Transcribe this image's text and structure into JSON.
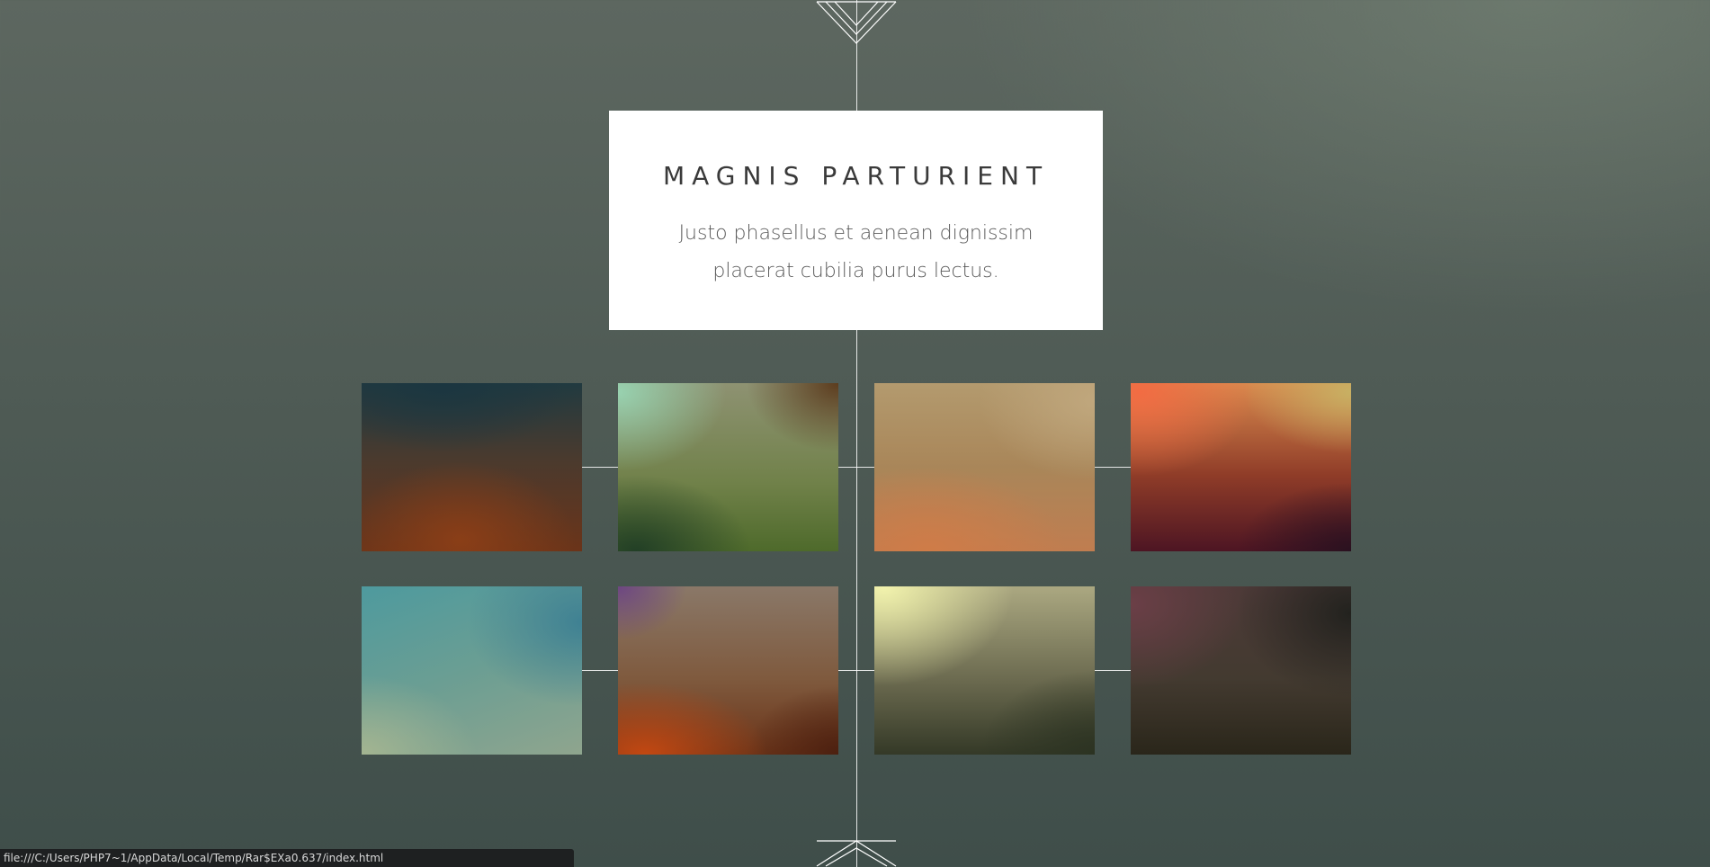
{
  "card": {
    "title": "MAGNIS PARTURIENT",
    "text_line1": "Justo phasellus et aenean dignissim",
    "text_line2": "placerat cubilia purus lectus."
  },
  "status_bar": {
    "url": "file:///C:/Users/PHP7~1/AppData/Local/Temp/Rar$EXa0.637/index.html"
  },
  "colors": {
    "background": "#4f5b55",
    "card": "#ffffff",
    "guide_line": "#ffffff"
  },
  "tiles": [
    {
      "name": "gradient-tile-dark-teal-rust",
      "colors": [
        "#1a3139",
        "#4a3a2c",
        "#7e3b18"
      ]
    },
    {
      "name": "gradient-tile-mint-olive",
      "colors": [
        "#8fc8a6",
        "#8f8b63",
        "#4d6b2f"
      ]
    },
    {
      "name": "gradient-tile-tan-orange",
      "colors": [
        "#b6996b",
        "#a98457",
        "#cc7a4a"
      ]
    },
    {
      "name": "gradient-tile-coral-plum",
      "colors": [
        "#ef7548",
        "#c7b05e",
        "#3c1321"
      ]
    },
    {
      "name": "gradient-tile-teal-sage",
      "colors": [
        "#4a9a9e",
        "#6f9f93",
        "#9aae8e"
      ]
    },
    {
      "name": "gradient-tile-purple-rust",
      "colors": [
        "#6e4b7f",
        "#8c7862",
        "#b7461b"
      ]
    },
    {
      "name": "gradient-tile-cream-olive",
      "colors": [
        "#eef0a8",
        "#8d8d6b",
        "#2f3424"
      ]
    },
    {
      "name": "gradient-tile-mauve-black",
      "colors": [
        "#6a3e46",
        "#4e4238",
        "#252218"
      ]
    }
  ]
}
